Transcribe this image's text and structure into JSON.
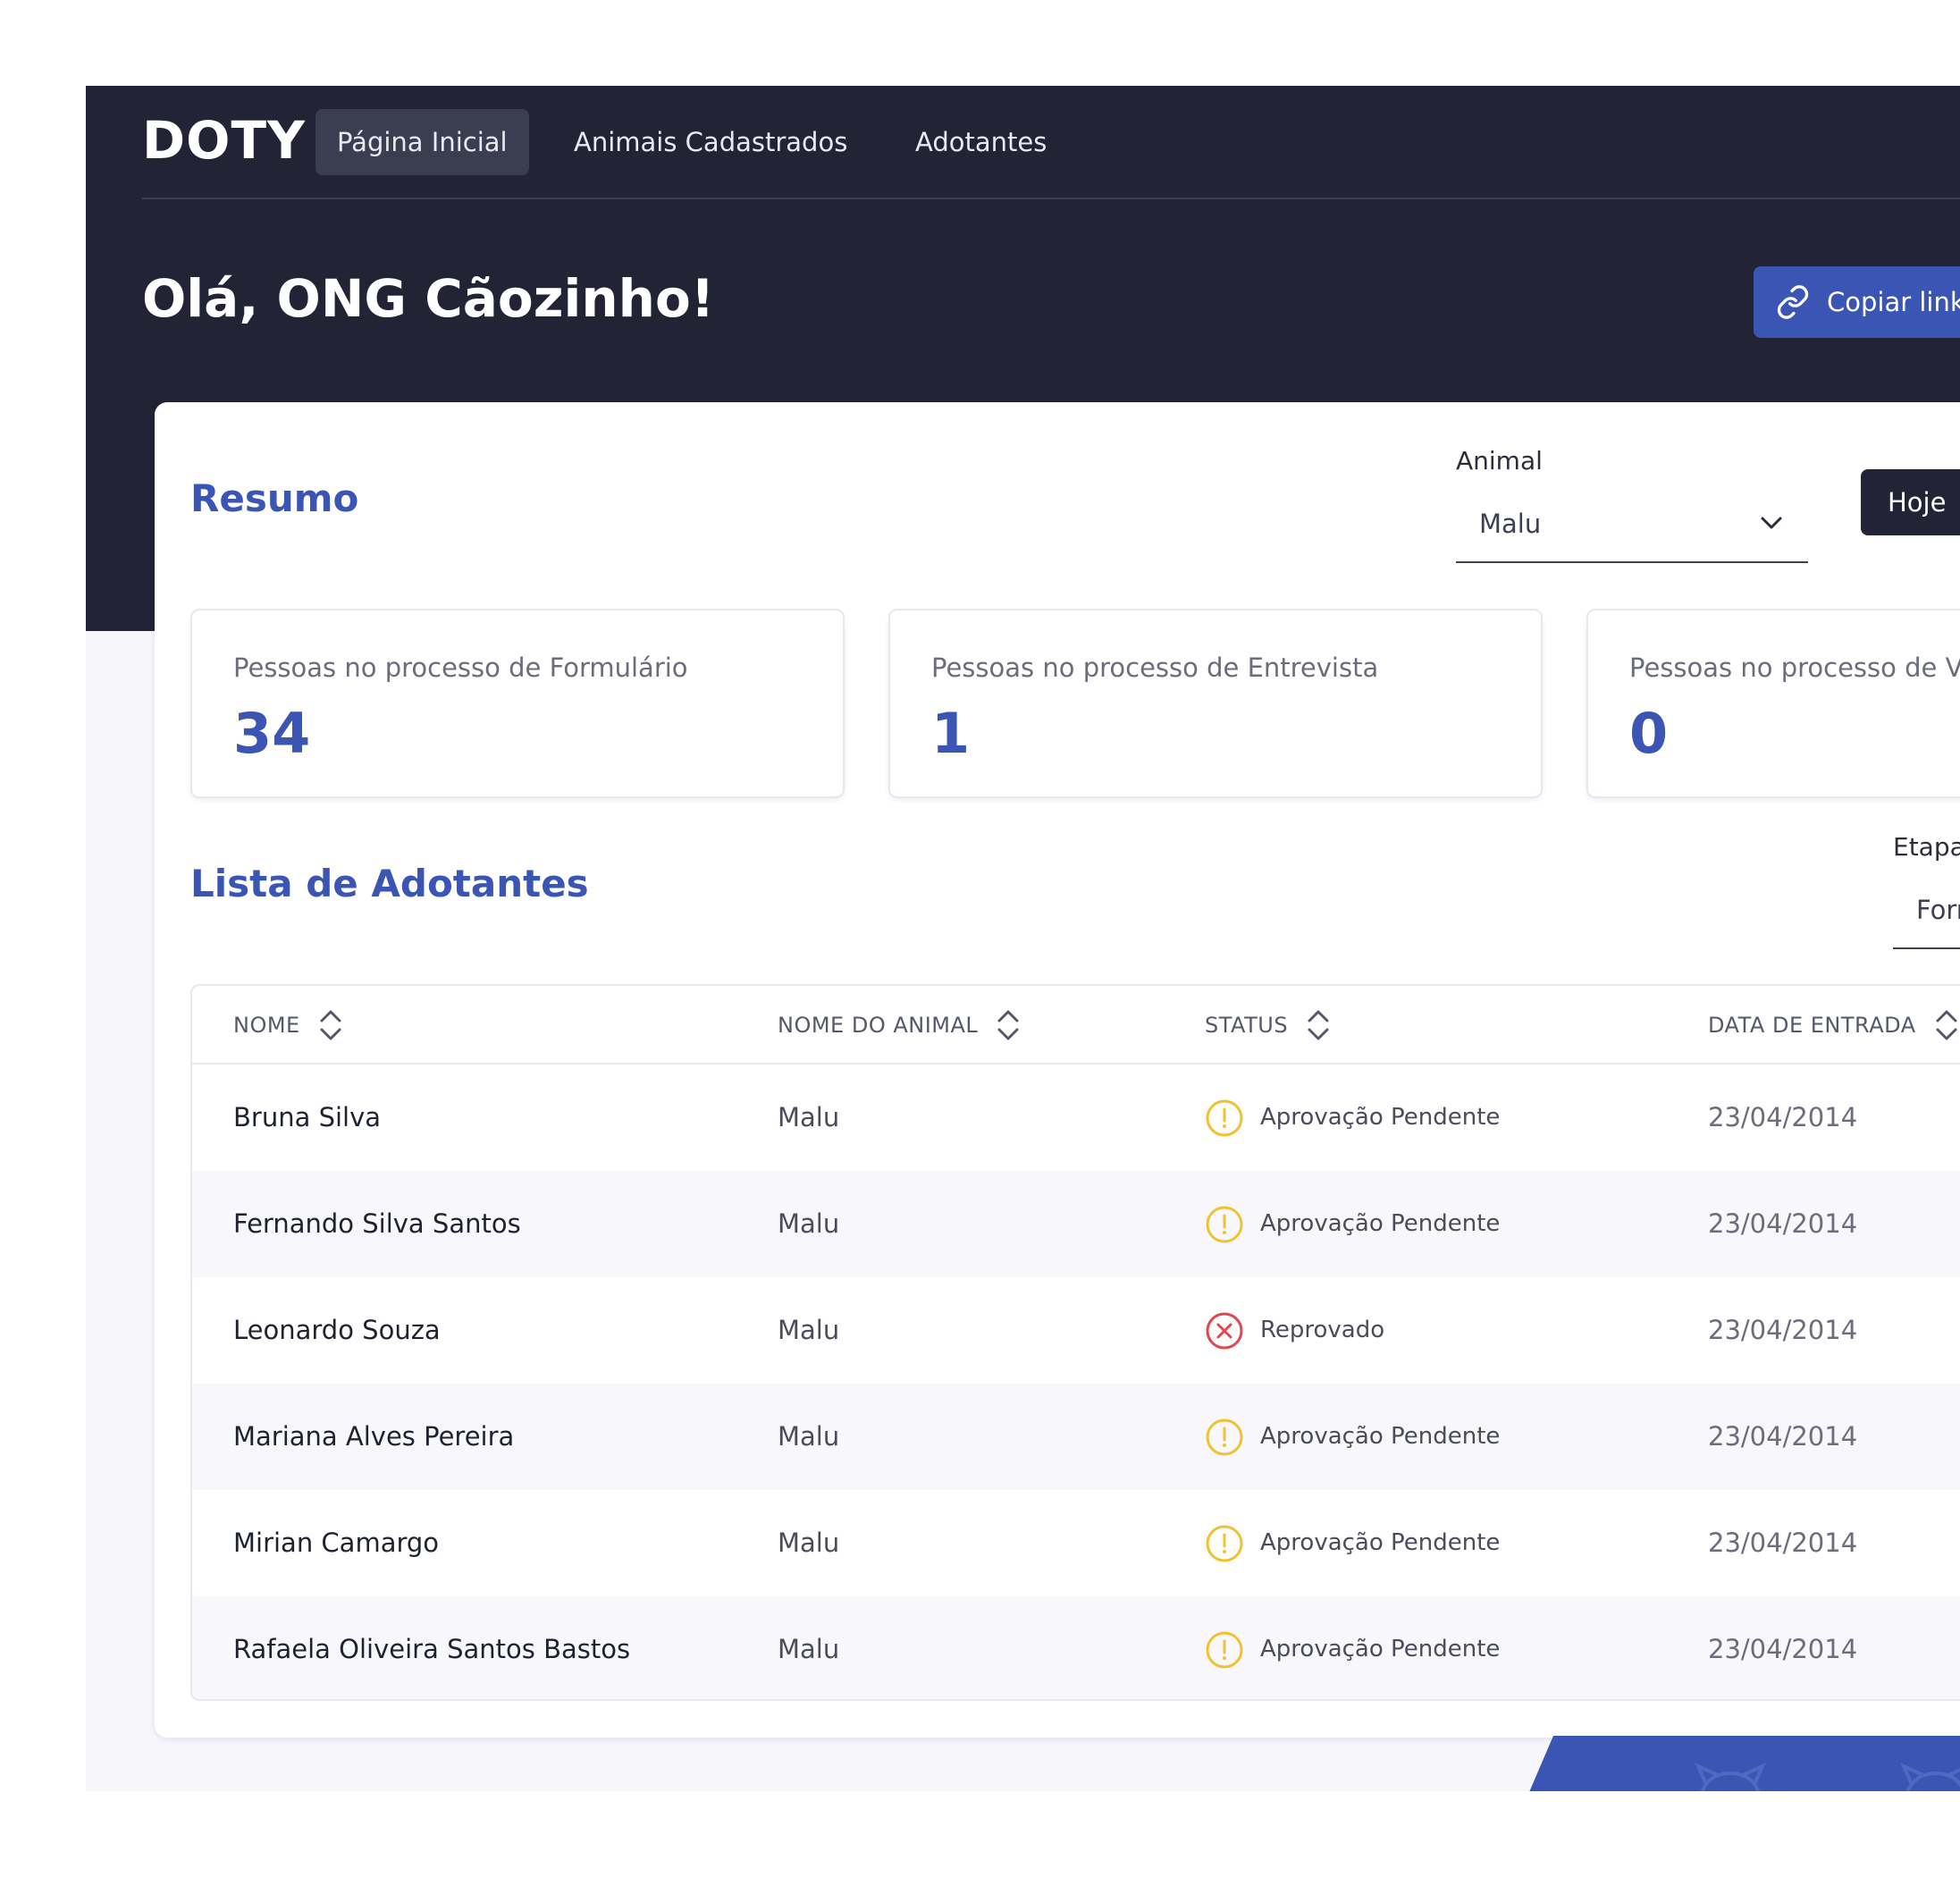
{
  "app": {
    "logo": "DOTY"
  },
  "nav": {
    "tabs": [
      {
        "label": "Página Inicial",
        "active": true
      },
      {
        "label": "Animais Cadastrados",
        "active": false
      },
      {
        "label": "Adotantes",
        "active": false
      }
    ]
  },
  "header": {
    "greeting": "Olá, ONG Cãozinho!",
    "copy_button": {
      "label": "Copiar link",
      "icon": "link-icon"
    }
  },
  "summary": {
    "title": "Resumo",
    "animal_filter": {
      "label": "Animal",
      "value": "Malu",
      "icon": "chevron-down-icon"
    },
    "period_button": "Hoje",
    "stats": [
      {
        "label": "Pessoas no processo de Formulário",
        "value": "34"
      },
      {
        "label": "Pessoas no processo de Entrevista",
        "value": "1"
      },
      {
        "label": "Pessoas no processo de Visita",
        "value": "0"
      }
    ]
  },
  "adopters": {
    "title": "Lista de Adotantes",
    "stage_filter": {
      "label": "Etapa",
      "value": "Formulário"
    },
    "columns": [
      "NOME",
      "NOME DO ANIMAL",
      "STATUS",
      "DATA DE ENTRADA"
    ],
    "rows": [
      {
        "name": "Bruna Silva",
        "animal": "Malu",
        "status": "Aprovação Pendente",
        "status_type": "pending",
        "date": "23/04/2014"
      },
      {
        "name": "Fernando Silva Santos",
        "animal": "Malu",
        "status": "Aprovação Pendente",
        "status_type": "pending",
        "date": "23/04/2014"
      },
      {
        "name": "Leonardo Souza",
        "animal": "Malu",
        "status": "Reprovado",
        "status_type": "rejected",
        "date": "23/04/2014"
      },
      {
        "name": "Mariana Alves Pereira",
        "animal": "Malu",
        "status": "Aprovação Pendente",
        "status_type": "pending",
        "date": "23/04/2014"
      },
      {
        "name": "Mirian Camargo",
        "animal": "Malu",
        "status": "Aprovação Pendente",
        "status_type": "pending",
        "date": "23/04/2014"
      },
      {
        "name": "Rafaela Oliveira Santos Bastos",
        "animal": "Malu",
        "status": "Aprovação Pendente",
        "status_type": "pending",
        "date": "23/04/2014"
      }
    ]
  },
  "colors": {
    "dark": "#222436",
    "accent": "#3a55b4",
    "pending": "#f0c233",
    "rejected": "#e0474f"
  }
}
